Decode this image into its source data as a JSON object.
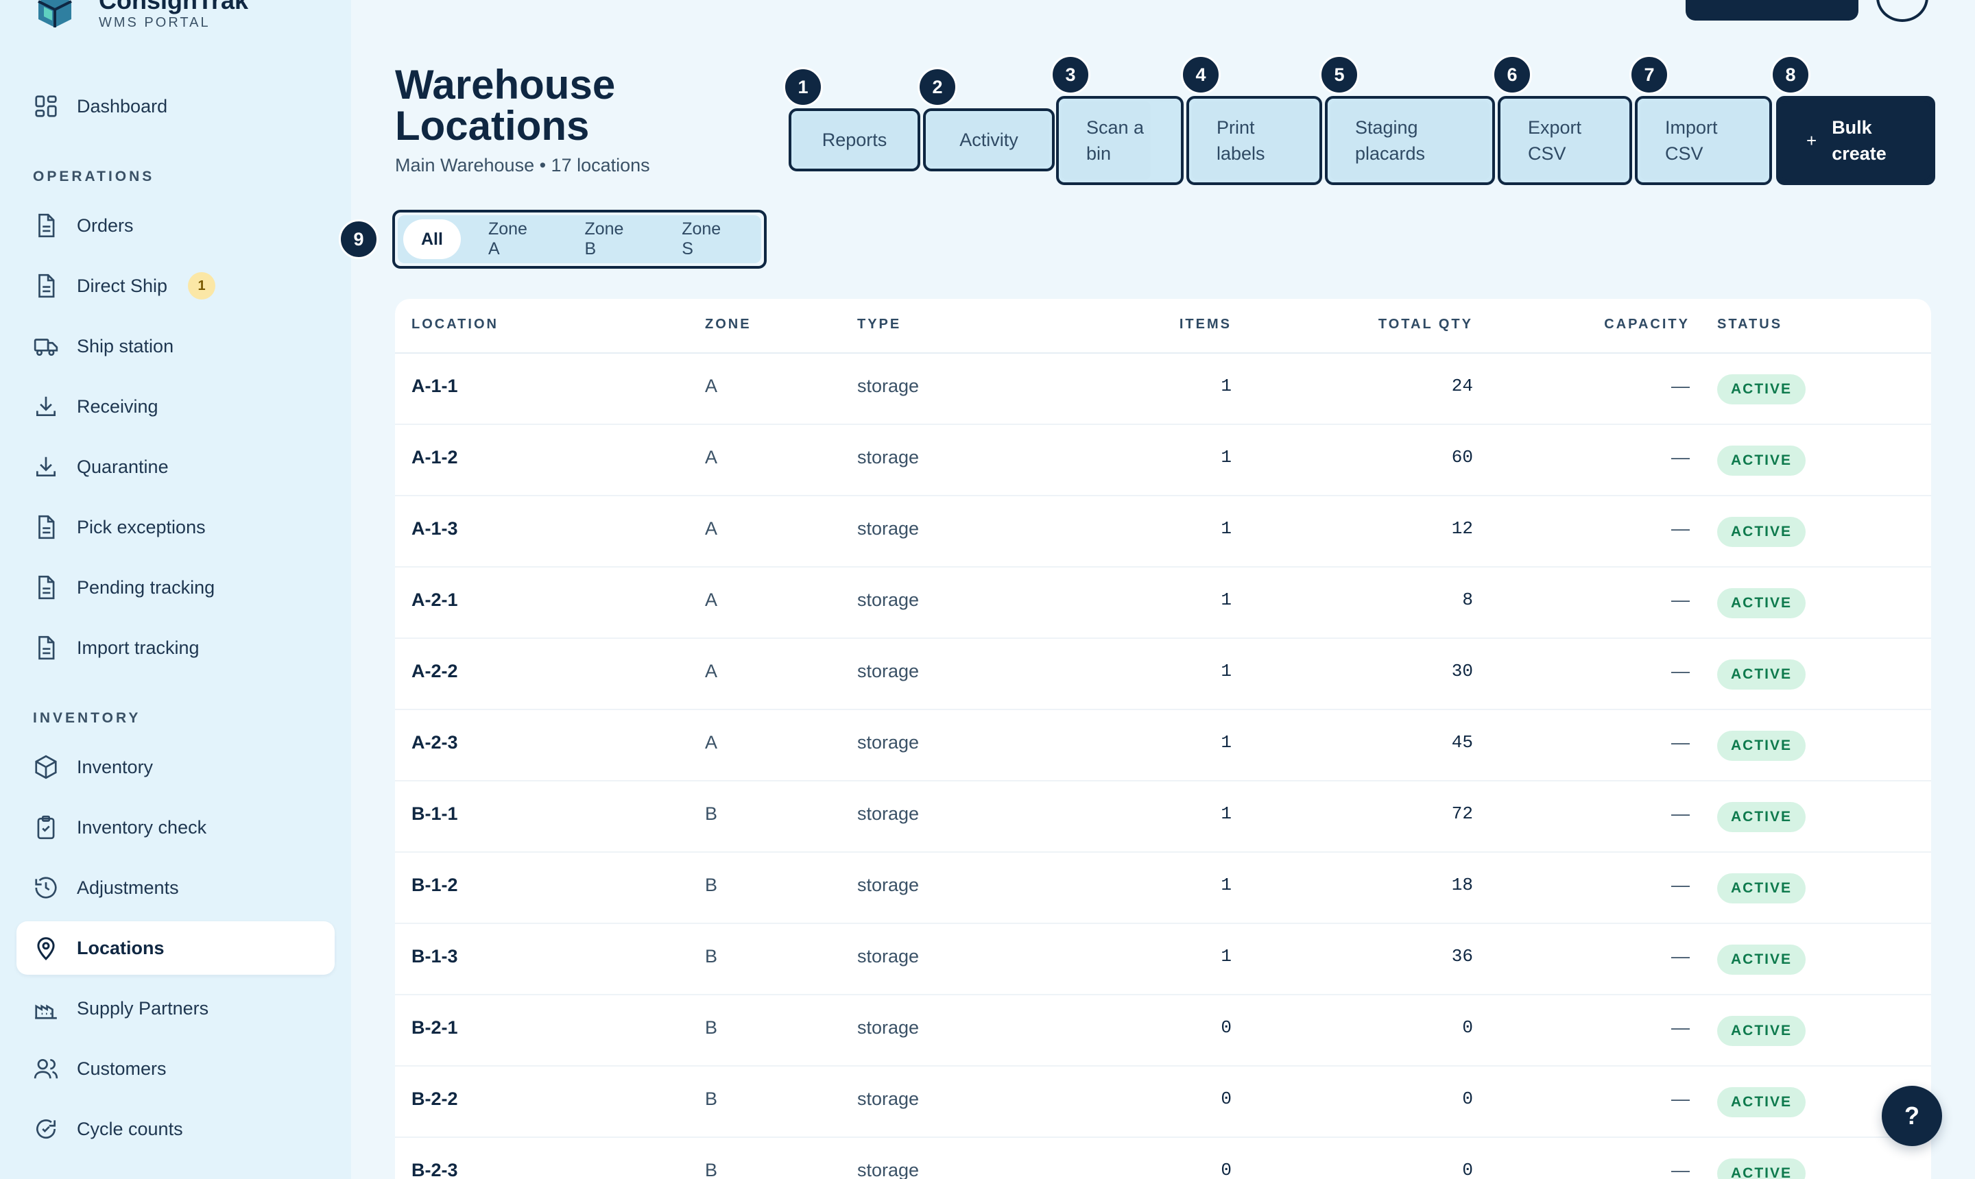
{
  "brand": {
    "name": "ConsignTrak",
    "subtitle": "WMS PORTAL"
  },
  "sidebar": {
    "dashboard": "Dashboard",
    "sections": {
      "operations": "OPERATIONS",
      "inventory": "INVENTORY"
    },
    "operations_items": [
      {
        "label": "Orders",
        "icon": "document-icon"
      },
      {
        "label": "Direct Ship",
        "icon": "document-icon",
        "badge": "1"
      },
      {
        "label": "Ship station",
        "icon": "truck-icon"
      },
      {
        "label": "Receiving",
        "icon": "download-icon"
      },
      {
        "label": "Quarantine",
        "icon": "download-icon"
      },
      {
        "label": "Pick exceptions",
        "icon": "document-icon"
      },
      {
        "label": "Pending tracking",
        "icon": "document-icon"
      },
      {
        "label": "Import tracking",
        "icon": "document-icon"
      }
    ],
    "inventory_items": [
      {
        "label": "Inventory",
        "icon": "box-icon"
      },
      {
        "label": "Inventory check",
        "icon": "clipboard-check-icon"
      },
      {
        "label": "Adjustments",
        "icon": "history-icon"
      },
      {
        "label": "Locations",
        "icon": "map-pin-icon",
        "active": true
      },
      {
        "label": "Supply Partners",
        "icon": "factory-icon"
      },
      {
        "label": "Customers",
        "icon": "users-icon"
      },
      {
        "label": "Cycle counts",
        "icon": "refresh-icon"
      }
    ]
  },
  "header": {
    "title": "Warehouse Locations",
    "subtitle": "Main Warehouse • 17 locations"
  },
  "actions": [
    {
      "marker": "1",
      "label": "Reports"
    },
    {
      "marker": "2",
      "label": "Activity"
    },
    {
      "marker": "3",
      "label": "Scan a bin"
    },
    {
      "marker": "4",
      "label": "Print labels"
    },
    {
      "marker": "5",
      "label": "Staging placards"
    },
    {
      "marker": "6",
      "label": "Export CSV"
    },
    {
      "marker": "7",
      "label": "Import CSV"
    },
    {
      "marker": "8",
      "label": "Bulk create",
      "plus": "+"
    }
  ],
  "tabs": {
    "marker": "9",
    "items": [
      {
        "label": "All",
        "active": true
      },
      {
        "label": "Zone A"
      },
      {
        "label": "Zone B"
      },
      {
        "label": "Zone S"
      }
    ]
  },
  "table": {
    "columns": {
      "location": "LOCATION",
      "zone": "ZONE",
      "type": "TYPE",
      "items": "ITEMS",
      "total_qty": "TOTAL QTY",
      "capacity": "CAPACITY",
      "status": "STATUS"
    },
    "rows": [
      {
        "location": "A-1-1",
        "zone": "A",
        "type": "storage",
        "items": "1",
        "total_qty": "24",
        "capacity": "—",
        "status": "ACTIVE"
      },
      {
        "location": "A-1-2",
        "zone": "A",
        "type": "storage",
        "items": "1",
        "total_qty": "60",
        "capacity": "—",
        "status": "ACTIVE"
      },
      {
        "location": "A-1-3",
        "zone": "A",
        "type": "storage",
        "items": "1",
        "total_qty": "12",
        "capacity": "—",
        "status": "ACTIVE"
      },
      {
        "location": "A-2-1",
        "zone": "A",
        "type": "storage",
        "items": "1",
        "total_qty": "8",
        "capacity": "—",
        "status": "ACTIVE"
      },
      {
        "location": "A-2-2",
        "zone": "A",
        "type": "storage",
        "items": "1",
        "total_qty": "30",
        "capacity": "—",
        "status": "ACTIVE"
      },
      {
        "location": "A-2-3",
        "zone": "A",
        "type": "storage",
        "items": "1",
        "total_qty": "45",
        "capacity": "—",
        "status": "ACTIVE"
      },
      {
        "location": "B-1-1",
        "zone": "B",
        "type": "storage",
        "items": "1",
        "total_qty": "72",
        "capacity": "—",
        "status": "ACTIVE"
      },
      {
        "location": "B-1-2",
        "zone": "B",
        "type": "storage",
        "items": "1",
        "total_qty": "18",
        "capacity": "—",
        "status": "ACTIVE"
      },
      {
        "location": "B-1-3",
        "zone": "B",
        "type": "storage",
        "items": "1",
        "total_qty": "36",
        "capacity": "—",
        "status": "ACTIVE"
      },
      {
        "location": "B-2-1",
        "zone": "B",
        "type": "storage",
        "items": "0",
        "total_qty": "0",
        "capacity": "—",
        "status": "ACTIVE"
      },
      {
        "location": "B-2-2",
        "zone": "B",
        "type": "storage",
        "items": "0",
        "total_qty": "0",
        "capacity": "—",
        "status": "ACTIVE"
      },
      {
        "location": "B-2-3",
        "zone": "B",
        "type": "storage",
        "items": "0",
        "total_qty": "0",
        "capacity": "—",
        "status": "ACTIVE"
      }
    ]
  },
  "help": {
    "label": "?"
  }
}
